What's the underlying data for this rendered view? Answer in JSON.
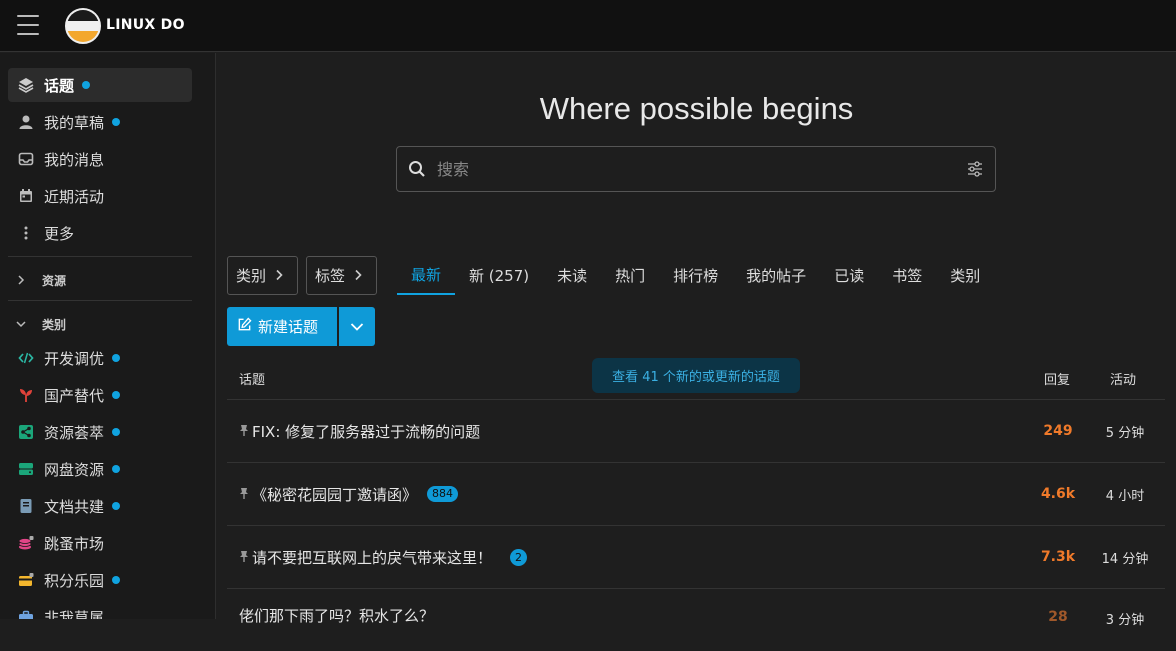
{
  "header": {
    "logo_text": "LINUX DO"
  },
  "sidebar": {
    "items": [
      {
        "label": "话题",
        "icon": "layers-icon",
        "dot": true,
        "active": true
      },
      {
        "label": "我的草稿",
        "icon": "user-icon",
        "dot": true
      },
      {
        "label": "我的消息",
        "icon": "inbox-icon",
        "dot": false
      },
      {
        "label": "近期活动",
        "icon": "calendar-icon",
        "dot": false
      },
      {
        "label": "更多",
        "icon": "more-vertical-icon",
        "dot": false
      }
    ],
    "section_resources": "资源",
    "section_categories": "类别",
    "categories": [
      {
        "label": "开发调优",
        "icon": "code-icon",
        "color": "#2bb8a4",
        "dot": true
      },
      {
        "label": "国产替代",
        "icon": "sprout-icon",
        "color": "#e0423a",
        "dot": true
      },
      {
        "label": "资源荟萃",
        "icon": "share-icon",
        "color": "#1ba67a",
        "dot": true
      },
      {
        "label": "网盘资源",
        "icon": "server-icon",
        "color": "#1ba67a",
        "dot": true
      },
      {
        "label": "文档共建",
        "icon": "book-icon",
        "color": "#7a9bb5",
        "dot": true
      },
      {
        "label": "跳蚤市场",
        "icon": "coins-icon",
        "color": "#e24587",
        "dot": false
      },
      {
        "label": "积分乐园",
        "icon": "card-icon",
        "color": "#f3b62d",
        "dot": true
      },
      {
        "label": "非我莫属",
        "icon": "briefcase-icon",
        "color": "#6fa3e0",
        "dot": false
      }
    ]
  },
  "hero": {
    "title": "Where possible begins"
  },
  "search": {
    "placeholder": "搜索"
  },
  "filters": {
    "category": "类别",
    "tags": "标签"
  },
  "nav": [
    "最新",
    "新 (257)",
    "未读",
    "热门",
    "排行榜",
    "我的帖子",
    "已读",
    "书签",
    "类别"
  ],
  "new_topic": "新建话题",
  "table": {
    "col_topic": "话题",
    "col_replies": "回复",
    "col_activity": "活动",
    "banner": "查看 41 个新的或更新的话题",
    "rows": [
      {
        "pinned": true,
        "title": "FIX: 修复了服务器过于流畅的问题",
        "badge": "",
        "replies": "249",
        "activity": "5 分钟"
      },
      {
        "pinned": true,
        "title": "《秘密花园园丁邀请函》",
        "badge": "884",
        "replies": "4.6k",
        "activity": "4 小时"
      },
      {
        "pinned": true,
        "title": "请不要把互联网上的戾气带来这里！",
        "badge": "2",
        "replies": "7.3k",
        "activity": "14 分钟"
      },
      {
        "pinned": false,
        "title": "佬们那下雨了吗？积水了么？",
        "badge": "",
        "replies": "28",
        "activity": "3 分钟"
      }
    ]
  },
  "colors": {
    "accent": "#10a3e0",
    "replies": "#f07a2a"
  }
}
